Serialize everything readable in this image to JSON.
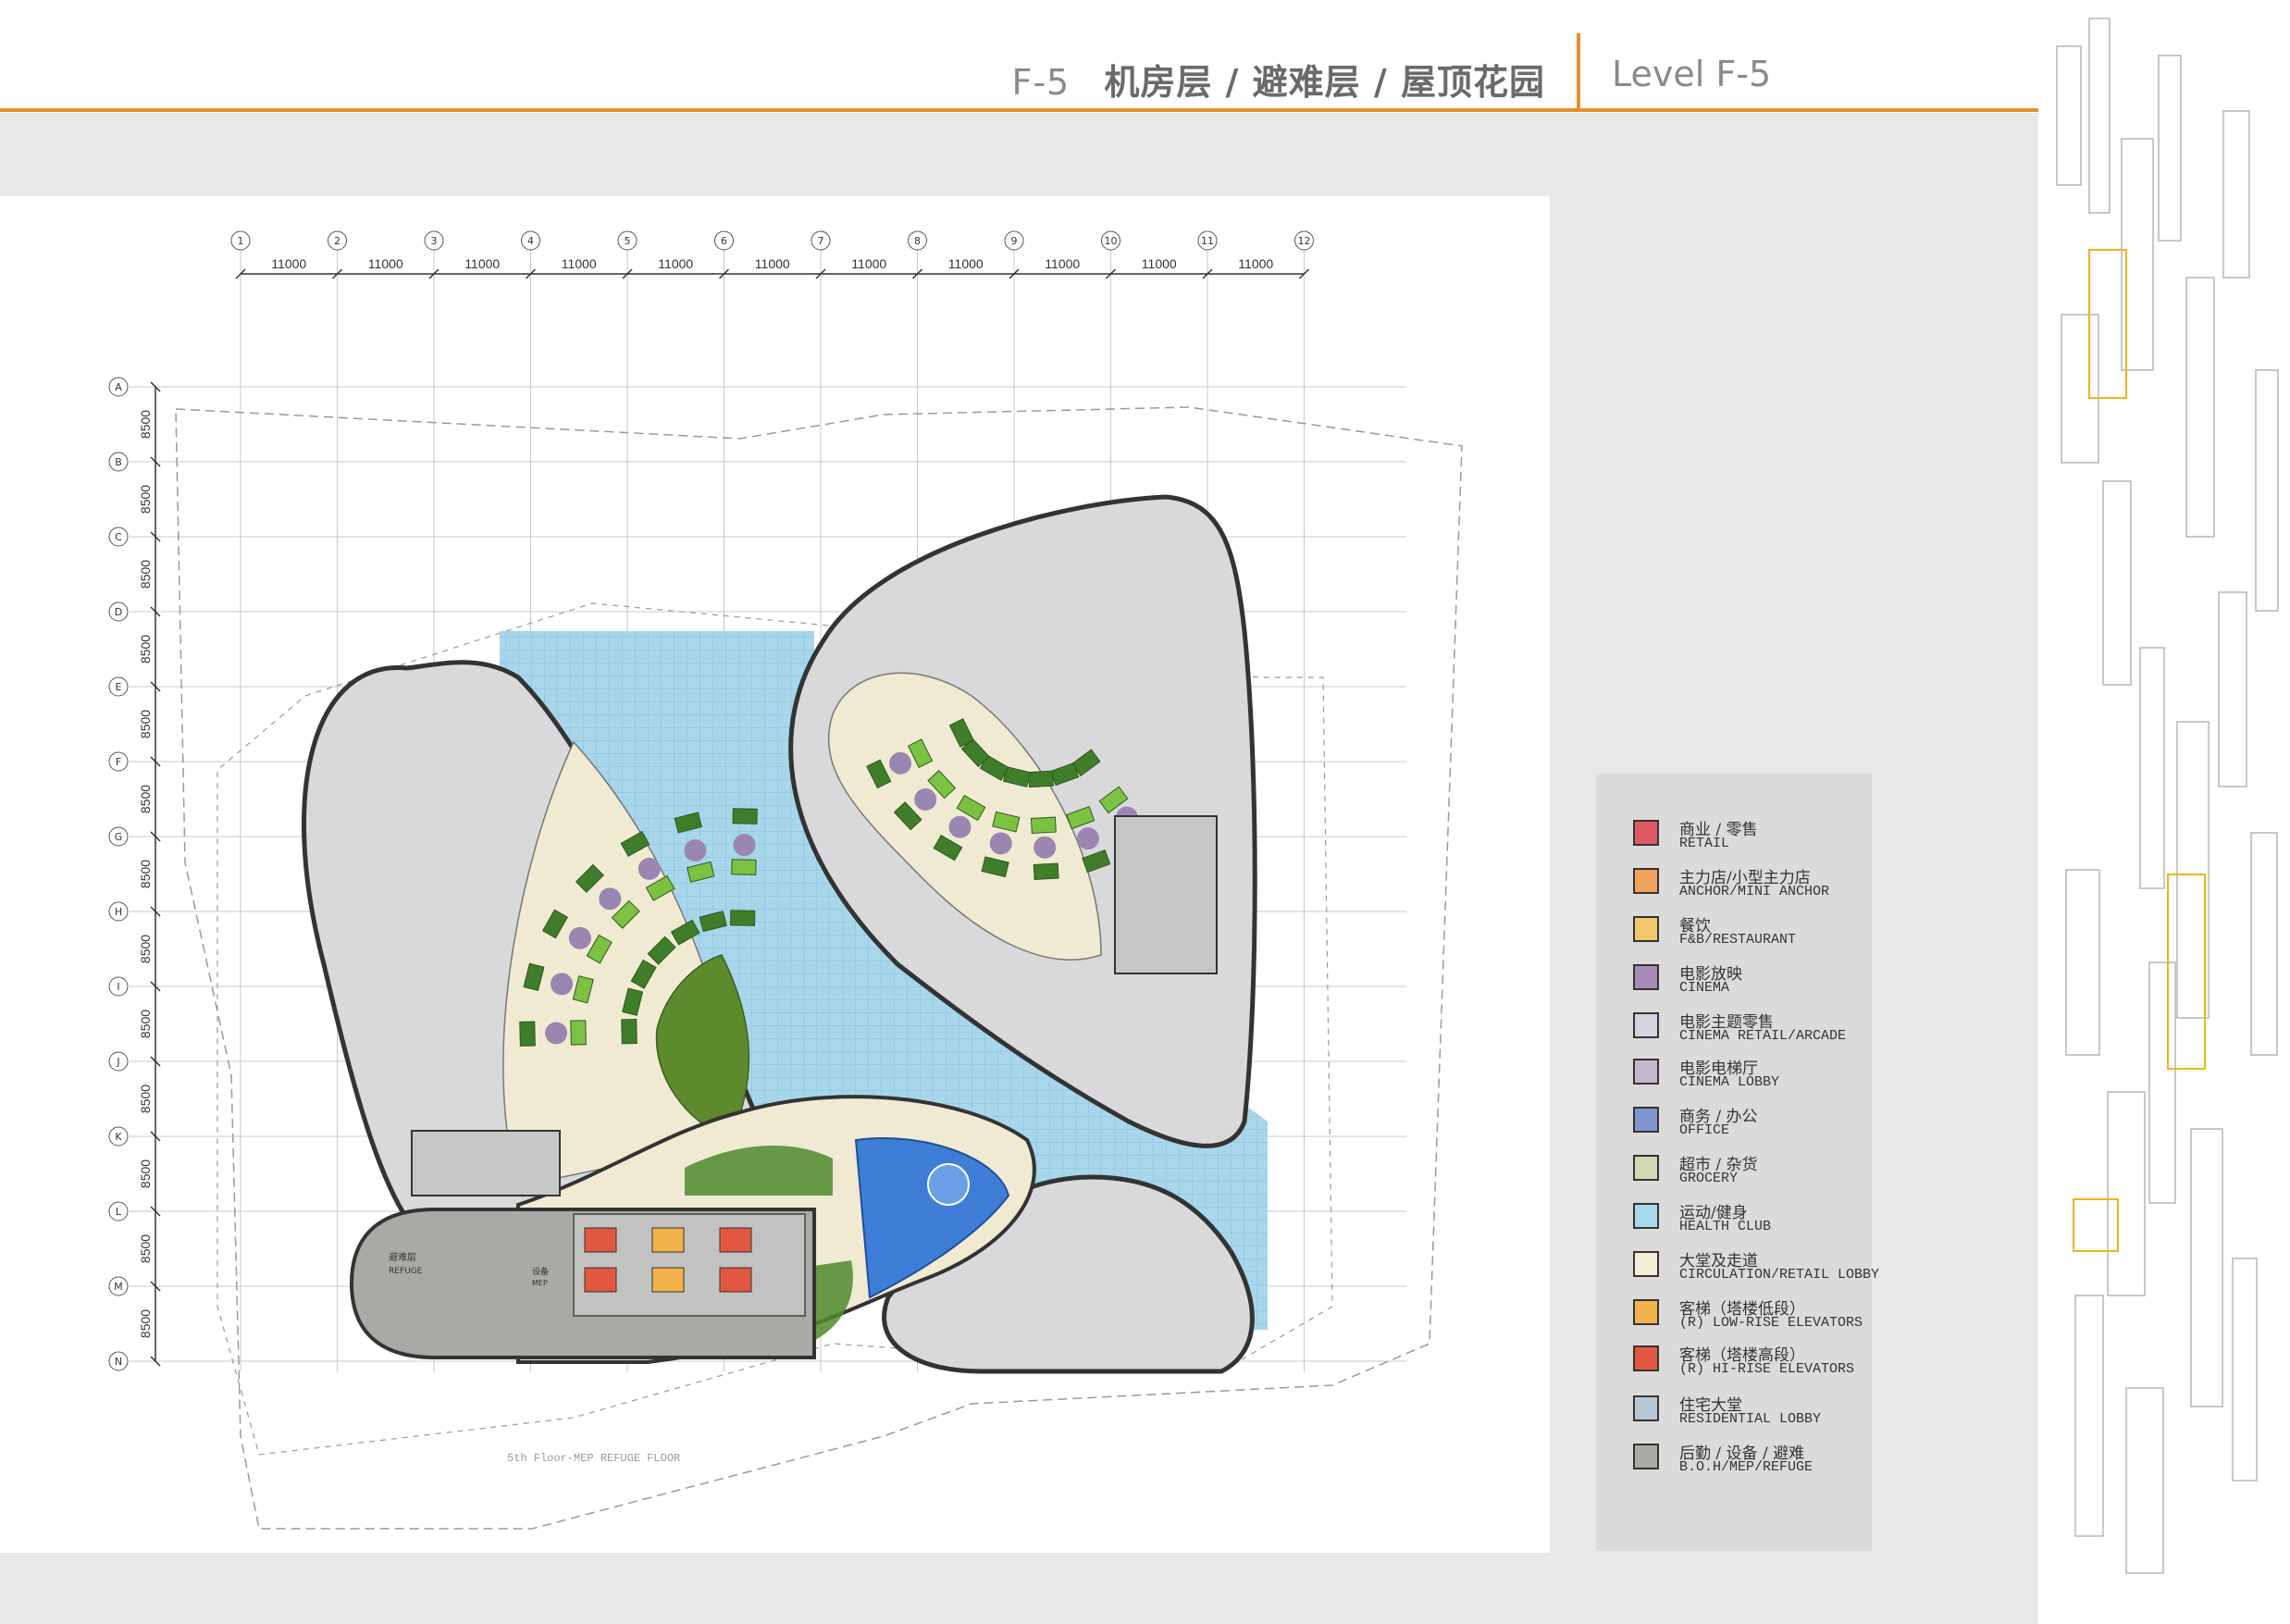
{
  "header": {
    "code": "F-5",
    "title_zh": "机房层 / 避难层 / 屋顶花园",
    "title_en": "Level F-5"
  },
  "plan": {
    "column_labels": [
      "1",
      "2",
      "3",
      "4",
      "5",
      "6",
      "7",
      "8",
      "9",
      "10",
      "11",
      "12"
    ],
    "column_spacing": "11000",
    "row_labels": [
      "A",
      "B",
      "C",
      "D",
      "E",
      "F",
      "G",
      "H",
      "I",
      "J",
      "K",
      "L",
      "M",
      "N"
    ],
    "row_spacing": "8500",
    "floor_note": "5th Floor-MEP REFUGE FLOOR",
    "refuge_label_zh": "避难层",
    "refuge_label_en": "REFUGE",
    "mep_label_zh": "设备",
    "mep_label_en": "MEP"
  },
  "legend": [
    {
      "zh": "商业 / 零售",
      "en": "RETAIL",
      "color": "#e05a66"
    },
    {
      "zh": "主力店/小型主力店",
      "en": "ANCHOR/MINI ANCHOR",
      "color": "#f0a25e"
    },
    {
      "zh": "餐饮",
      "en": "F&B/RESTAURANT",
      "color": "#f2c66a"
    },
    {
      "zh": "电影放映",
      "en": "CINEMA",
      "color": "#a58bb4"
    },
    {
      "zh": "电影主题零售",
      "en": "CINEMA RETAIL/ARCADE",
      "color": "#d6d2e0"
    },
    {
      "zh": "电影电梯厅",
      "en": "CINEMA LOBBY",
      "color": "#c4b8cc"
    },
    {
      "zh": "商务 / 办公",
      "en": "OFFICE",
      "color": "#7f95cf"
    },
    {
      "zh": "超市 / 杂货",
      "en": "GROCERY",
      "color": "#cfd9b4"
    },
    {
      "zh": "运动/健身",
      "en": "HEALTH CLUB",
      "color": "#a9d8ec"
    },
    {
      "zh": "大堂及走道",
      "en": "CIRCULATION/RETAIL LOBBY",
      "color": "#f3ecd6"
    },
    {
      "zh": "客梯（塔楼低段）",
      "en": "(R) LOW-RISE ELEVATORS",
      "color": "#f2b24c"
    },
    {
      "zh": "客梯（塔楼高段）",
      "en": "(R) HI-RISE ELEVATORS",
      "color": "#e2573f"
    },
    {
      "zh": "住宅大堂",
      "en": "RESIDENTIAL LOBBY",
      "color": "#b7c9d8"
    },
    {
      "zh": "后勤 / 设备 / 避难",
      "en": "B.O.H/MEP/REFUGE",
      "color": "#a9aaa6"
    }
  ]
}
